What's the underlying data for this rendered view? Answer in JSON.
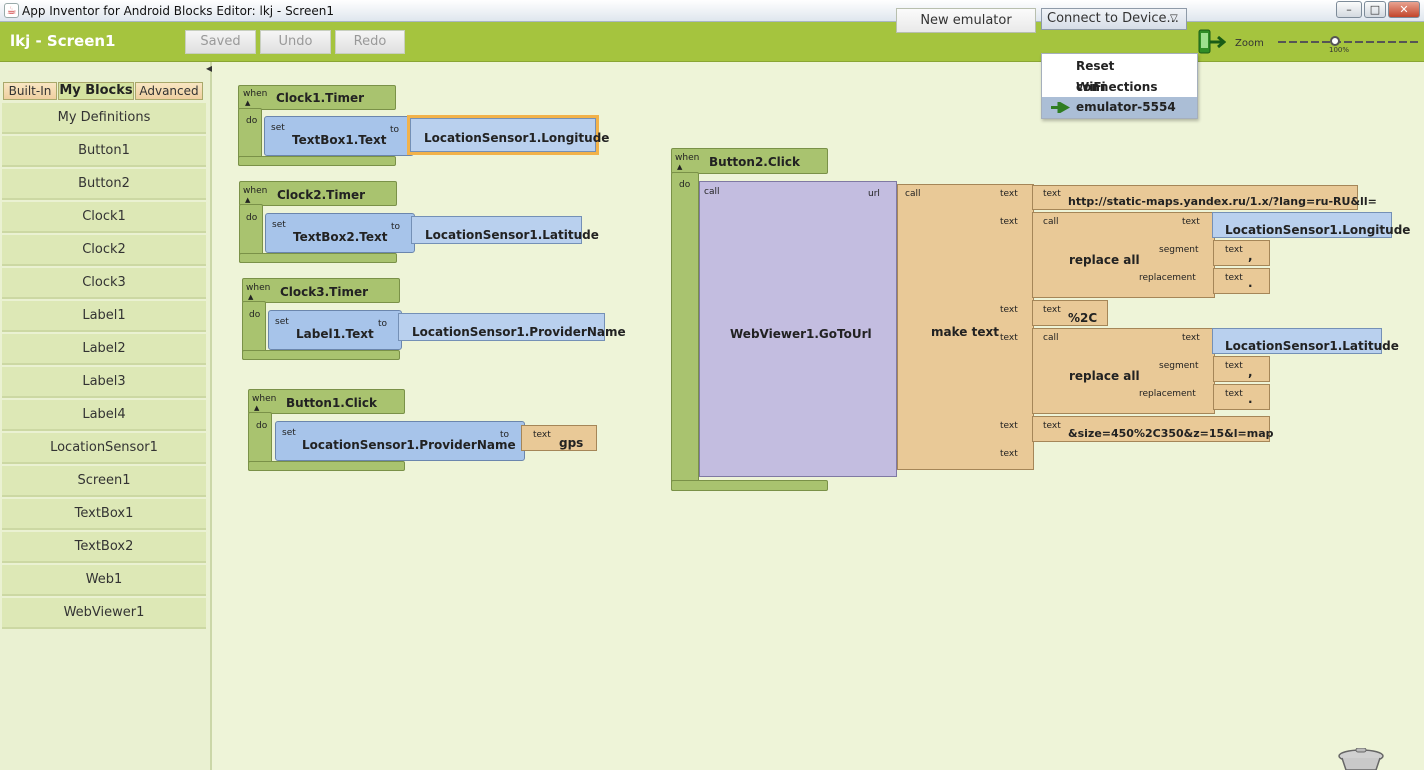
{
  "window": {
    "title": "App Inventor for Android Blocks Editor: lkj - Screen1",
    "minimize_label": "–",
    "maximize_label": "□",
    "close_label": "✕",
    "java_icon_label": "☕"
  },
  "toolbar": {
    "project": "lkj - Screen1",
    "saved_label": "Saved",
    "undo_label": "Undo",
    "redo_label": "Redo",
    "new_emulator_label": "New emulator",
    "connect_label": "Connect to Device...",
    "connect_caret": "▽",
    "zoom_label": "Zoom",
    "zoom_value": "100%"
  },
  "connect_menu": {
    "items": [
      "Reset connections",
      "WiFi",
      "emulator-5554"
    ],
    "selected_index": 2
  },
  "sidebar": {
    "tabs": [
      "Built-In",
      "My Blocks",
      "Advanced"
    ],
    "active_tab": "My Blocks",
    "collapse_glyph": "◀",
    "items": [
      "My Definitions",
      "Button1",
      "Button2",
      "Clock1",
      "Clock2",
      "Clock3",
      "Label1",
      "Label2",
      "Label3",
      "Label4",
      "LocationSensor1",
      "Screen1",
      "TextBox1",
      "TextBox2",
      "Web1",
      "WebViewer1"
    ]
  },
  "blocks": {
    "when": "when",
    "do": "do",
    "set": "set",
    "to": "to",
    "call": "call",
    "url": "url",
    "text": "text",
    "segment": "segment",
    "replacement": "replacement",
    "expand_glyph": "▲",
    "clock1": {
      "event": "Clock1.Timer",
      "target": "TextBox1.Text",
      "value": "LocationSensor1.Longitude"
    },
    "clock2": {
      "event": "Clock2.Timer",
      "target": "TextBox2.Text",
      "value": "LocationSensor1.Latitude"
    },
    "clock3": {
      "event": "Clock3.Timer",
      "target": "Label1.Text",
      "value": "LocationSensor1.ProviderName"
    },
    "button1": {
      "event": "Button1.Click",
      "target": "LocationSensor1.ProviderName",
      "value": "gps"
    },
    "button2": {
      "event": "Button2.Click",
      "method": "WebViewer1.GoToUrl",
      "join": "make text",
      "part1": "http://static-maps.yandex.ru/1.x/?lang=ru-RU&ll=",
      "replace1": {
        "op": "replace all",
        "text": "LocationSensor1.Longitude",
        "segment": ",",
        "replacement": "."
      },
      "part3": "%2C",
      "replace2": {
        "op": "replace all",
        "text": "LocationSensor1.Latitude",
        "segment": ",",
        "replacement": "."
      },
      "part5": "&size=450%2C350&z=15&l=map"
    }
  },
  "colors": {
    "toolbar_green": "#a5c43e",
    "event_block": "#a9c36f",
    "component_block": "#b9d0ee",
    "text_block": "#e9c997",
    "method_block": "#c3bde0",
    "workspace": "#eef4d8",
    "selected_highlight": "#f2b24a"
  }
}
